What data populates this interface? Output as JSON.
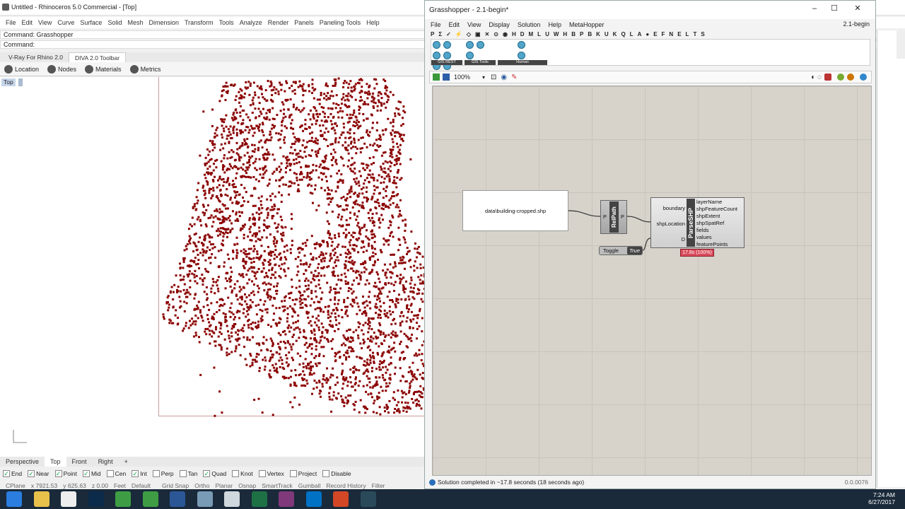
{
  "rhino": {
    "title": "Untitled - Rhinoceros 5.0 Commercial - [Top]",
    "menu": [
      "File",
      "Edit",
      "View",
      "Curve",
      "Surface",
      "Solid",
      "Mesh",
      "Dimension",
      "Transform",
      "Tools",
      "Analyze",
      "Render",
      "Panels",
      "Paneling Tools",
      "Help"
    ],
    "command_history": "Command: Grasshopper",
    "command_prompt": "Command:",
    "toolbar_tabs": [
      "V-Ray For Rhino 2.0",
      "DIVA 2.0 Toolbar"
    ],
    "diva_buttons": [
      "Location",
      "Nodes",
      "Materials",
      "Metrics"
    ],
    "viewport_label": "Top",
    "viewport_tabs": [
      "Perspective",
      "Top",
      "Front",
      "Right"
    ],
    "osnaps": [
      {
        "label": "End",
        "checked": true
      },
      {
        "label": "Near",
        "checked": true
      },
      {
        "label": "Point",
        "checked": true
      },
      {
        "label": "Mid",
        "checked": true
      },
      {
        "label": "Cen",
        "checked": false
      },
      {
        "label": "Int",
        "checked": true
      },
      {
        "label": "Perp",
        "checked": false
      },
      {
        "label": "Tan",
        "checked": false
      },
      {
        "label": "Quad",
        "checked": true
      },
      {
        "label": "Knot",
        "checked": false
      },
      {
        "label": "Vertex",
        "checked": false
      },
      {
        "label": "Project",
        "checked": false
      },
      {
        "label": "Disable",
        "checked": false
      }
    ],
    "status": {
      "cplane": "CPlane",
      "x": "x 7921.53",
      "y": "y 625.63",
      "z": "z 0.00",
      "units": "Feet",
      "layer": "Default",
      "toggles": [
        "Grid Snap",
        "Ortho",
        "Planar",
        "Osnap",
        "SmartTrack",
        "Gumball",
        "Record History",
        "Filter"
      ]
    },
    "point_color": "#8b0000"
  },
  "grasshopper": {
    "title": "Grasshopper - 2.1-begin*",
    "menu": [
      "File",
      "Edit",
      "View",
      "Display",
      "Solution",
      "Help",
      "MetaHopper"
    ],
    "document_name": "2.1-begin",
    "tabs": [
      "P",
      "Σ",
      "✓",
      "⚡",
      "◇",
      "▣",
      "✕",
      "⊙",
      "◉",
      "H",
      "D",
      "M",
      "L",
      "U",
      "W",
      "H",
      "B",
      "P",
      "B",
      "K",
      "U",
      "K",
      "Q",
      "L",
      "A",
      "●",
      "E",
      "F",
      "N",
      "E",
      "L",
      "T",
      "S"
    ],
    "ribbon_groups": [
      "GIS REST",
      "GIS Tools",
      "Human"
    ],
    "zoom": "100%",
    "components": {
      "panel_text": "data\\building-cropped.shp",
      "relpath": {
        "name": "RelPath",
        "input": "P",
        "output": "P"
      },
      "parse": {
        "name": "ParseSHP",
        "inputs": [
          "boundary",
          "shpLocation",
          "D"
        ],
        "outputs": [
          "layerName",
          "shpFeatureCount",
          "shpExtent",
          "shpSpatRef",
          "fields",
          "values",
          "featurePoints"
        ]
      },
      "toggle": {
        "label": "Toggle",
        "value": "True"
      },
      "progress": "17.8s (100%)"
    },
    "status_text": "Solution completed in ~17.8 seconds (18 seconds ago)",
    "version": "0.0.0076",
    "canvas_color": "#d7d3cb"
  },
  "taskbar": {
    "time": "7:24 AM",
    "date": "6/27/2017",
    "apps": [
      "windows",
      "file-explorer",
      "rhino",
      "photoshop",
      "chrome",
      "chrome",
      "word",
      "network",
      "remote",
      "excel",
      "onenote",
      "outlook",
      "powerpoint",
      "grasshopper"
    ]
  }
}
